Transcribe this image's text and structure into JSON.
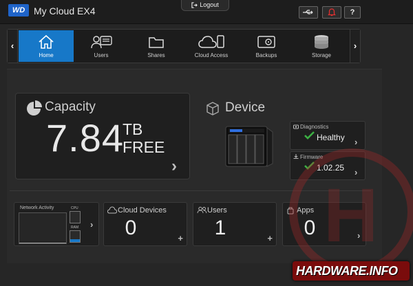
{
  "header": {
    "logo_text": "WD",
    "app_title": "My Cloud EX4",
    "logout_label": "Logout",
    "help_label": "?"
  },
  "nav": {
    "items": [
      {
        "label": "Home",
        "icon": "home-icon",
        "active": true
      },
      {
        "label": "Users",
        "icon": "users-icon"
      },
      {
        "label": "Shares",
        "icon": "folder-icon"
      },
      {
        "label": "Cloud Access",
        "icon": "cloud-access-icon"
      },
      {
        "label": "Backups",
        "icon": "backups-icon"
      },
      {
        "label": "Storage",
        "icon": "storage-icon"
      }
    ]
  },
  "capacity": {
    "title": "Capacity",
    "value": "7.84",
    "unit": "TB",
    "free_label": "FREE"
  },
  "device": {
    "title": "Device",
    "diagnostics_label": "Diagnostics",
    "diagnostics_value": "Healthy",
    "firmware_label": "Firmware",
    "firmware_value": "1.02.25"
  },
  "network": {
    "title": "Network Activity",
    "cpu_label": "CPU",
    "ram_label": "RAM",
    "cpu_level": 0.0,
    "ram_level": 0.25
  },
  "tiles": {
    "cloud_devices": {
      "label": "Cloud Devices",
      "value": "0"
    },
    "users": {
      "label": "Users",
      "value": "1"
    },
    "apps": {
      "label": "Apps",
      "value": "0"
    }
  },
  "watermark": {
    "text": "HARDWARE.INFO"
  },
  "colors": {
    "accent": "#1778c8",
    "ok": "#3cb043",
    "alert": "#e03030"
  }
}
